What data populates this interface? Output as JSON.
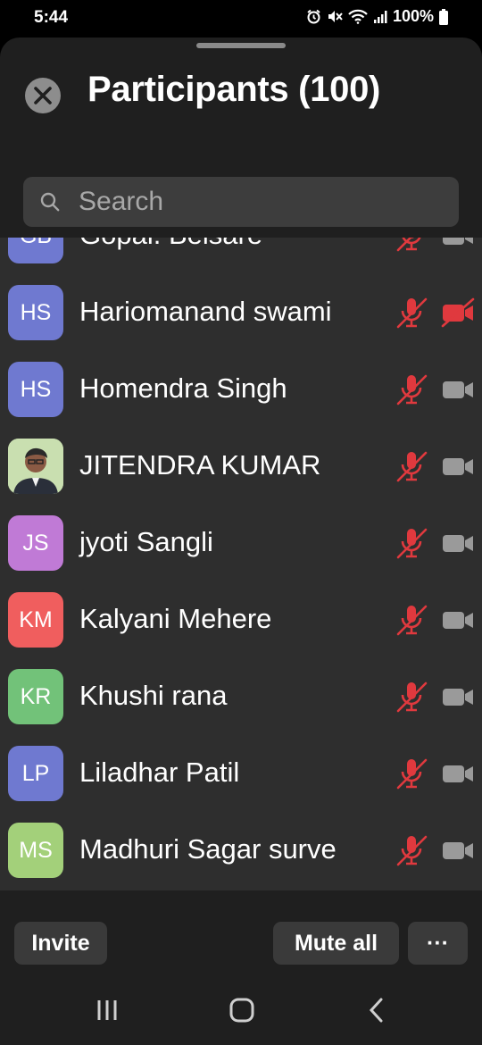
{
  "status_bar": {
    "time": "5:44",
    "battery": "100%",
    "icons": [
      "alarm-icon",
      "mute-icon",
      "wifi-icon",
      "signal-icon",
      "battery-icon"
    ]
  },
  "header": {
    "title": "Participants (100)"
  },
  "search": {
    "placeholder": "Search"
  },
  "participants": [
    {
      "initials": "GB",
      "name": "Gopal. Belsare",
      "avatar_color": "#6f79d0",
      "photo": false,
      "mic_muted": true,
      "video_off": false
    },
    {
      "initials": "HS",
      "name": "Hariomanand swami",
      "avatar_color": "#6f79d0",
      "photo": false,
      "mic_muted": true,
      "video_off": true
    },
    {
      "initials": "HS",
      "name": "Homendra Singh",
      "avatar_color": "#6f79d0",
      "photo": false,
      "mic_muted": true,
      "video_off": false
    },
    {
      "initials": "",
      "name": "JITENDRA KUMAR",
      "avatar_color": "#bcd6a2",
      "photo": true,
      "mic_muted": true,
      "video_off": false
    },
    {
      "initials": "JS",
      "name": "jyoti Sangli",
      "avatar_color": "#c07ad6",
      "photo": false,
      "mic_muted": true,
      "video_off": false
    },
    {
      "initials": "KM",
      "name": "Kalyani Mehere",
      "avatar_color": "#f05e5e",
      "photo": false,
      "mic_muted": true,
      "video_off": false
    },
    {
      "initials": "KR",
      "name": "Khushi rana",
      "avatar_color": "#72c279",
      "photo": false,
      "mic_muted": true,
      "video_off": false
    },
    {
      "initials": "LP",
      "name": "Liladhar Patil",
      "avatar_color": "#6f79d0",
      "photo": false,
      "mic_muted": true,
      "video_off": false
    },
    {
      "initials": "MS",
      "name": "Madhuri Sagar surve",
      "avatar_color": "#a3d07a",
      "photo": false,
      "mic_muted": true,
      "video_off": false
    }
  ],
  "footer": {
    "invite": "Invite",
    "mute_all": "Mute all",
    "more": "···"
  },
  "colors": {
    "muted_red": "#e0393e",
    "cam_gray": "#9a9a9a"
  }
}
